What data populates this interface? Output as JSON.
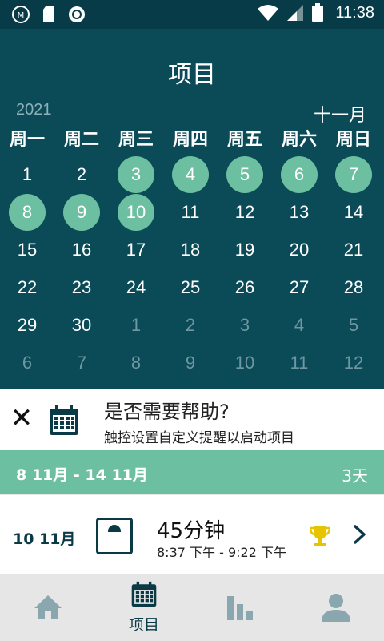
{
  "status": {
    "time": "11:38"
  },
  "header": {
    "title": "项目",
    "year": "2021",
    "month": "十一月"
  },
  "weekdays": [
    "周一",
    "周二",
    "周三",
    "周四",
    "周五",
    "周六",
    "周日"
  ],
  "calendar": [
    [
      {
        "d": "1",
        "s": "normal"
      },
      {
        "d": "2",
        "s": "normal"
      },
      {
        "d": "3",
        "s": "active"
      },
      {
        "d": "4",
        "s": "active"
      },
      {
        "d": "5",
        "s": "active"
      },
      {
        "d": "6",
        "s": "active"
      },
      {
        "d": "7",
        "s": "active"
      }
    ],
    [
      {
        "d": "8",
        "s": "active"
      },
      {
        "d": "9",
        "s": "active"
      },
      {
        "d": "10",
        "s": "active"
      },
      {
        "d": "11",
        "s": "normal"
      },
      {
        "d": "12",
        "s": "normal"
      },
      {
        "d": "13",
        "s": "normal"
      },
      {
        "d": "14",
        "s": "normal"
      }
    ],
    [
      {
        "d": "15",
        "s": "normal"
      },
      {
        "d": "16",
        "s": "normal"
      },
      {
        "d": "17",
        "s": "normal"
      },
      {
        "d": "18",
        "s": "normal"
      },
      {
        "d": "19",
        "s": "normal"
      },
      {
        "d": "20",
        "s": "normal"
      },
      {
        "d": "21",
        "s": "normal"
      }
    ],
    [
      {
        "d": "22",
        "s": "normal"
      },
      {
        "d": "23",
        "s": "normal"
      },
      {
        "d": "24",
        "s": "normal"
      },
      {
        "d": "25",
        "s": "normal"
      },
      {
        "d": "26",
        "s": "normal"
      },
      {
        "d": "27",
        "s": "normal"
      },
      {
        "d": "28",
        "s": "normal"
      }
    ],
    [
      {
        "d": "29",
        "s": "normal"
      },
      {
        "d": "30",
        "s": "normal"
      },
      {
        "d": "1",
        "s": "other"
      },
      {
        "d": "2",
        "s": "other"
      },
      {
        "d": "3",
        "s": "other"
      },
      {
        "d": "4",
        "s": "other"
      },
      {
        "d": "5",
        "s": "other"
      }
    ],
    [
      {
        "d": "6",
        "s": "other"
      },
      {
        "d": "7",
        "s": "other"
      },
      {
        "d": "8",
        "s": "other"
      },
      {
        "d": "9",
        "s": "other"
      },
      {
        "d": "10",
        "s": "other"
      },
      {
        "d": "11",
        "s": "other"
      },
      {
        "d": "12",
        "s": "other"
      }
    ]
  ],
  "help": {
    "close_icon": "close-icon",
    "title": "是否需要帮助?",
    "subtitle": "触控设置自定义提醒以启动项目"
  },
  "week": {
    "range": "8 11月 - 14 11月",
    "days": "3天"
  },
  "entry": {
    "date": "10 11月",
    "duration": "45分钟",
    "time": "8:37 下午 - 9:22 下午"
  },
  "nav": {
    "projects_label": "项目"
  },
  "colors": {
    "header_bg": "#0b4a57",
    "accent": "#6cc0a1",
    "trophy": "#e8c400"
  }
}
